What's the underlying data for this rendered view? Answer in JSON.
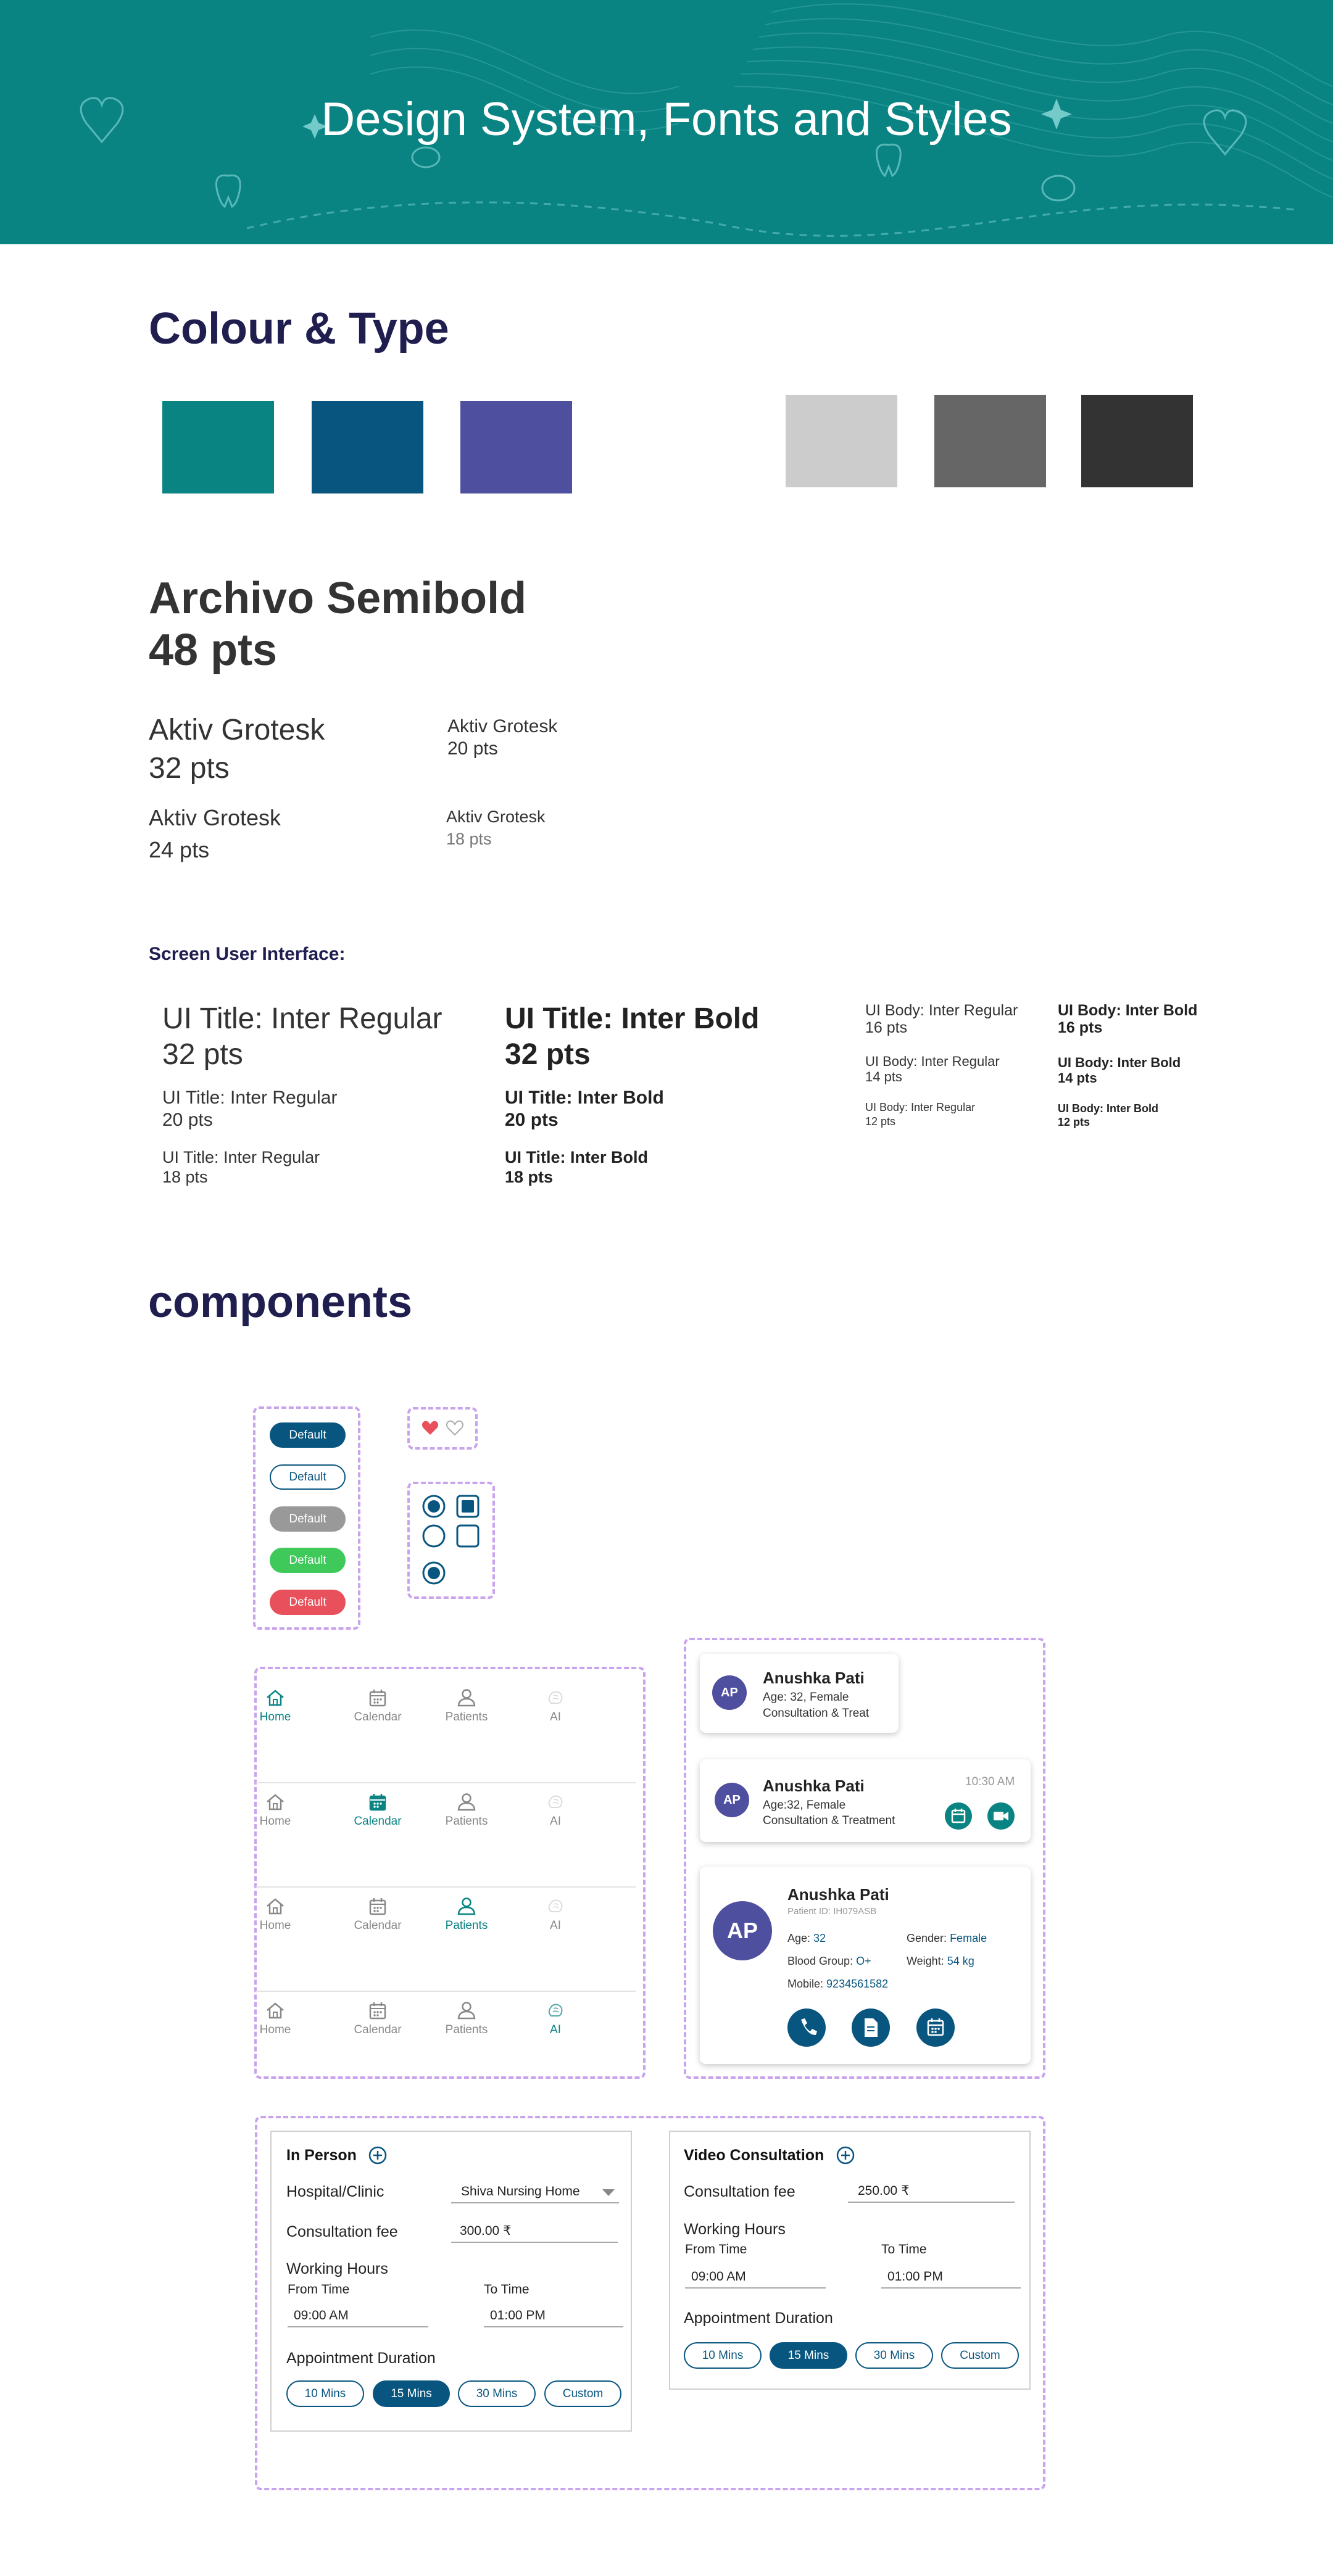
{
  "banner": {
    "title": "Design System, Fonts and Styles"
  },
  "colour_section": {
    "title": "Colour & Type",
    "swatches": [
      "#0a8383",
      "#08567f",
      "#4f4fa0",
      "#cccccc",
      "#666666",
      "#333333"
    ]
  },
  "typography": {
    "archivo": {
      "line1": "Archivo Semibold",
      "line2": "48 pts"
    },
    "aktiv32": {
      "line1": "Aktiv Grotesk",
      "line2": "32 pts"
    },
    "aktiv20": {
      "line1": "Aktiv Grotesk",
      "line2": "20 pts"
    },
    "aktiv24": {
      "line1": "Aktiv Grotesk",
      "line2": "24 pts"
    },
    "aktiv18": {
      "line1": "Aktiv Grotesk",
      "line2": "18 pts"
    }
  },
  "screen_ui": {
    "heading": "Screen User Interface:",
    "title_regular": [
      {
        "line1": "UI Title: Inter Regular",
        "line2": "32 pts"
      },
      {
        "line1": "UI Title: Inter Regular",
        "line2": "20 pts"
      },
      {
        "line1": "UI Title: Inter Regular",
        "line2": "18 pts"
      }
    ],
    "title_bold": [
      {
        "line1": "UI Title: Inter Bold",
        "line2": "32 pts"
      },
      {
        "line1": "UI Title: Inter Bold",
        "line2": "20 pts"
      },
      {
        "line1": "UI Title: Inter Bold",
        "line2": "18 pts"
      }
    ],
    "body_regular": [
      {
        "line1": "UI Body: Inter Regular",
        "line2": "16 pts"
      },
      {
        "line1": "UI Body: Inter Regular",
        "line2": "14 pts"
      },
      {
        "line1": "UI Body: Inter Regular",
        "line2": "12 pts"
      }
    ],
    "body_bold": [
      {
        "line1": "UI Body: Inter Bold",
        "line2": "16 pts"
      },
      {
        "line1": "UI Body: Inter Bold",
        "line2": "14 pts"
      },
      {
        "line1": "UI Body: Inter Bold",
        "line2": "12 pts"
      }
    ]
  },
  "components": {
    "title": "components",
    "buttons": [
      {
        "label": "Default",
        "style": "filled",
        "color": "#08567f"
      },
      {
        "label": "Default",
        "style": "outline",
        "color": "#08567f"
      },
      {
        "label": "Default",
        "style": "filled",
        "color": "#999999"
      },
      {
        "label": "Default",
        "style": "filled",
        "color": "#3ec95a"
      },
      {
        "label": "Default",
        "style": "filled",
        "color": "#e8505b"
      }
    ],
    "favorites": {
      "filled_color": "#e8505b",
      "outline_color": "#aaaaaa"
    },
    "nav": {
      "items": [
        "Home",
        "Calendar",
        "Patients",
        "AI"
      ],
      "active_indices": [
        0,
        1,
        2,
        3
      ]
    },
    "patient_card_small": {
      "initials": "AP",
      "name": "Anushka Pati",
      "line1": "Age: 32, Female",
      "line2": "Consultation & Treat"
    },
    "patient_card_medium": {
      "initials": "AP",
      "name": "Anushka Pati",
      "line1": "Age:32, Female",
      "line2": "Consultation & Treatment",
      "time": "10:30 AM"
    },
    "patient_card_large": {
      "initials": "AP",
      "name": "Anushka Pati",
      "patient_id": "Patient ID: IH079ASB",
      "age_label": "Age:",
      "age": "32",
      "gender_label": "Gender:",
      "gender": "Female",
      "blood_label": "Blood Group:",
      "blood": "O+",
      "weight_label": "Weight:",
      "weight": "54 kg",
      "mobile_label": "Mobile:",
      "mobile": "9234561582"
    },
    "in_person": {
      "title": "In Person",
      "hospital_label": "Hospital/Clinic",
      "hospital_value": "Shiva Nursing Home",
      "fee_label": "Consultation fee",
      "fee_value": "300.00 ₹",
      "hours_label": "Working Hours",
      "from_label": "From Time",
      "from_value": "09:00 AM",
      "to_label": "To Time",
      "to_value": "01:00 PM",
      "duration_label": "Appointment Duration",
      "durations": [
        "10 Mins",
        "15 Mins",
        "30 Mins",
        "Custom"
      ],
      "selected_duration": "15 Mins"
    },
    "video": {
      "title": "Video Consultation",
      "fee_label": "Consultation fee",
      "fee_value": "250.00 ₹",
      "hours_label": "Working Hours",
      "from_label": "From Time",
      "from_value": "09:00 AM",
      "to_label": "To Time",
      "to_value": "01:00 PM",
      "duration_label": "Appointment Duration",
      "durations": [
        "10 Mins",
        "15 Mins",
        "30 Mins",
        "Custom"
      ],
      "selected_duration": "15 Mins"
    }
  }
}
